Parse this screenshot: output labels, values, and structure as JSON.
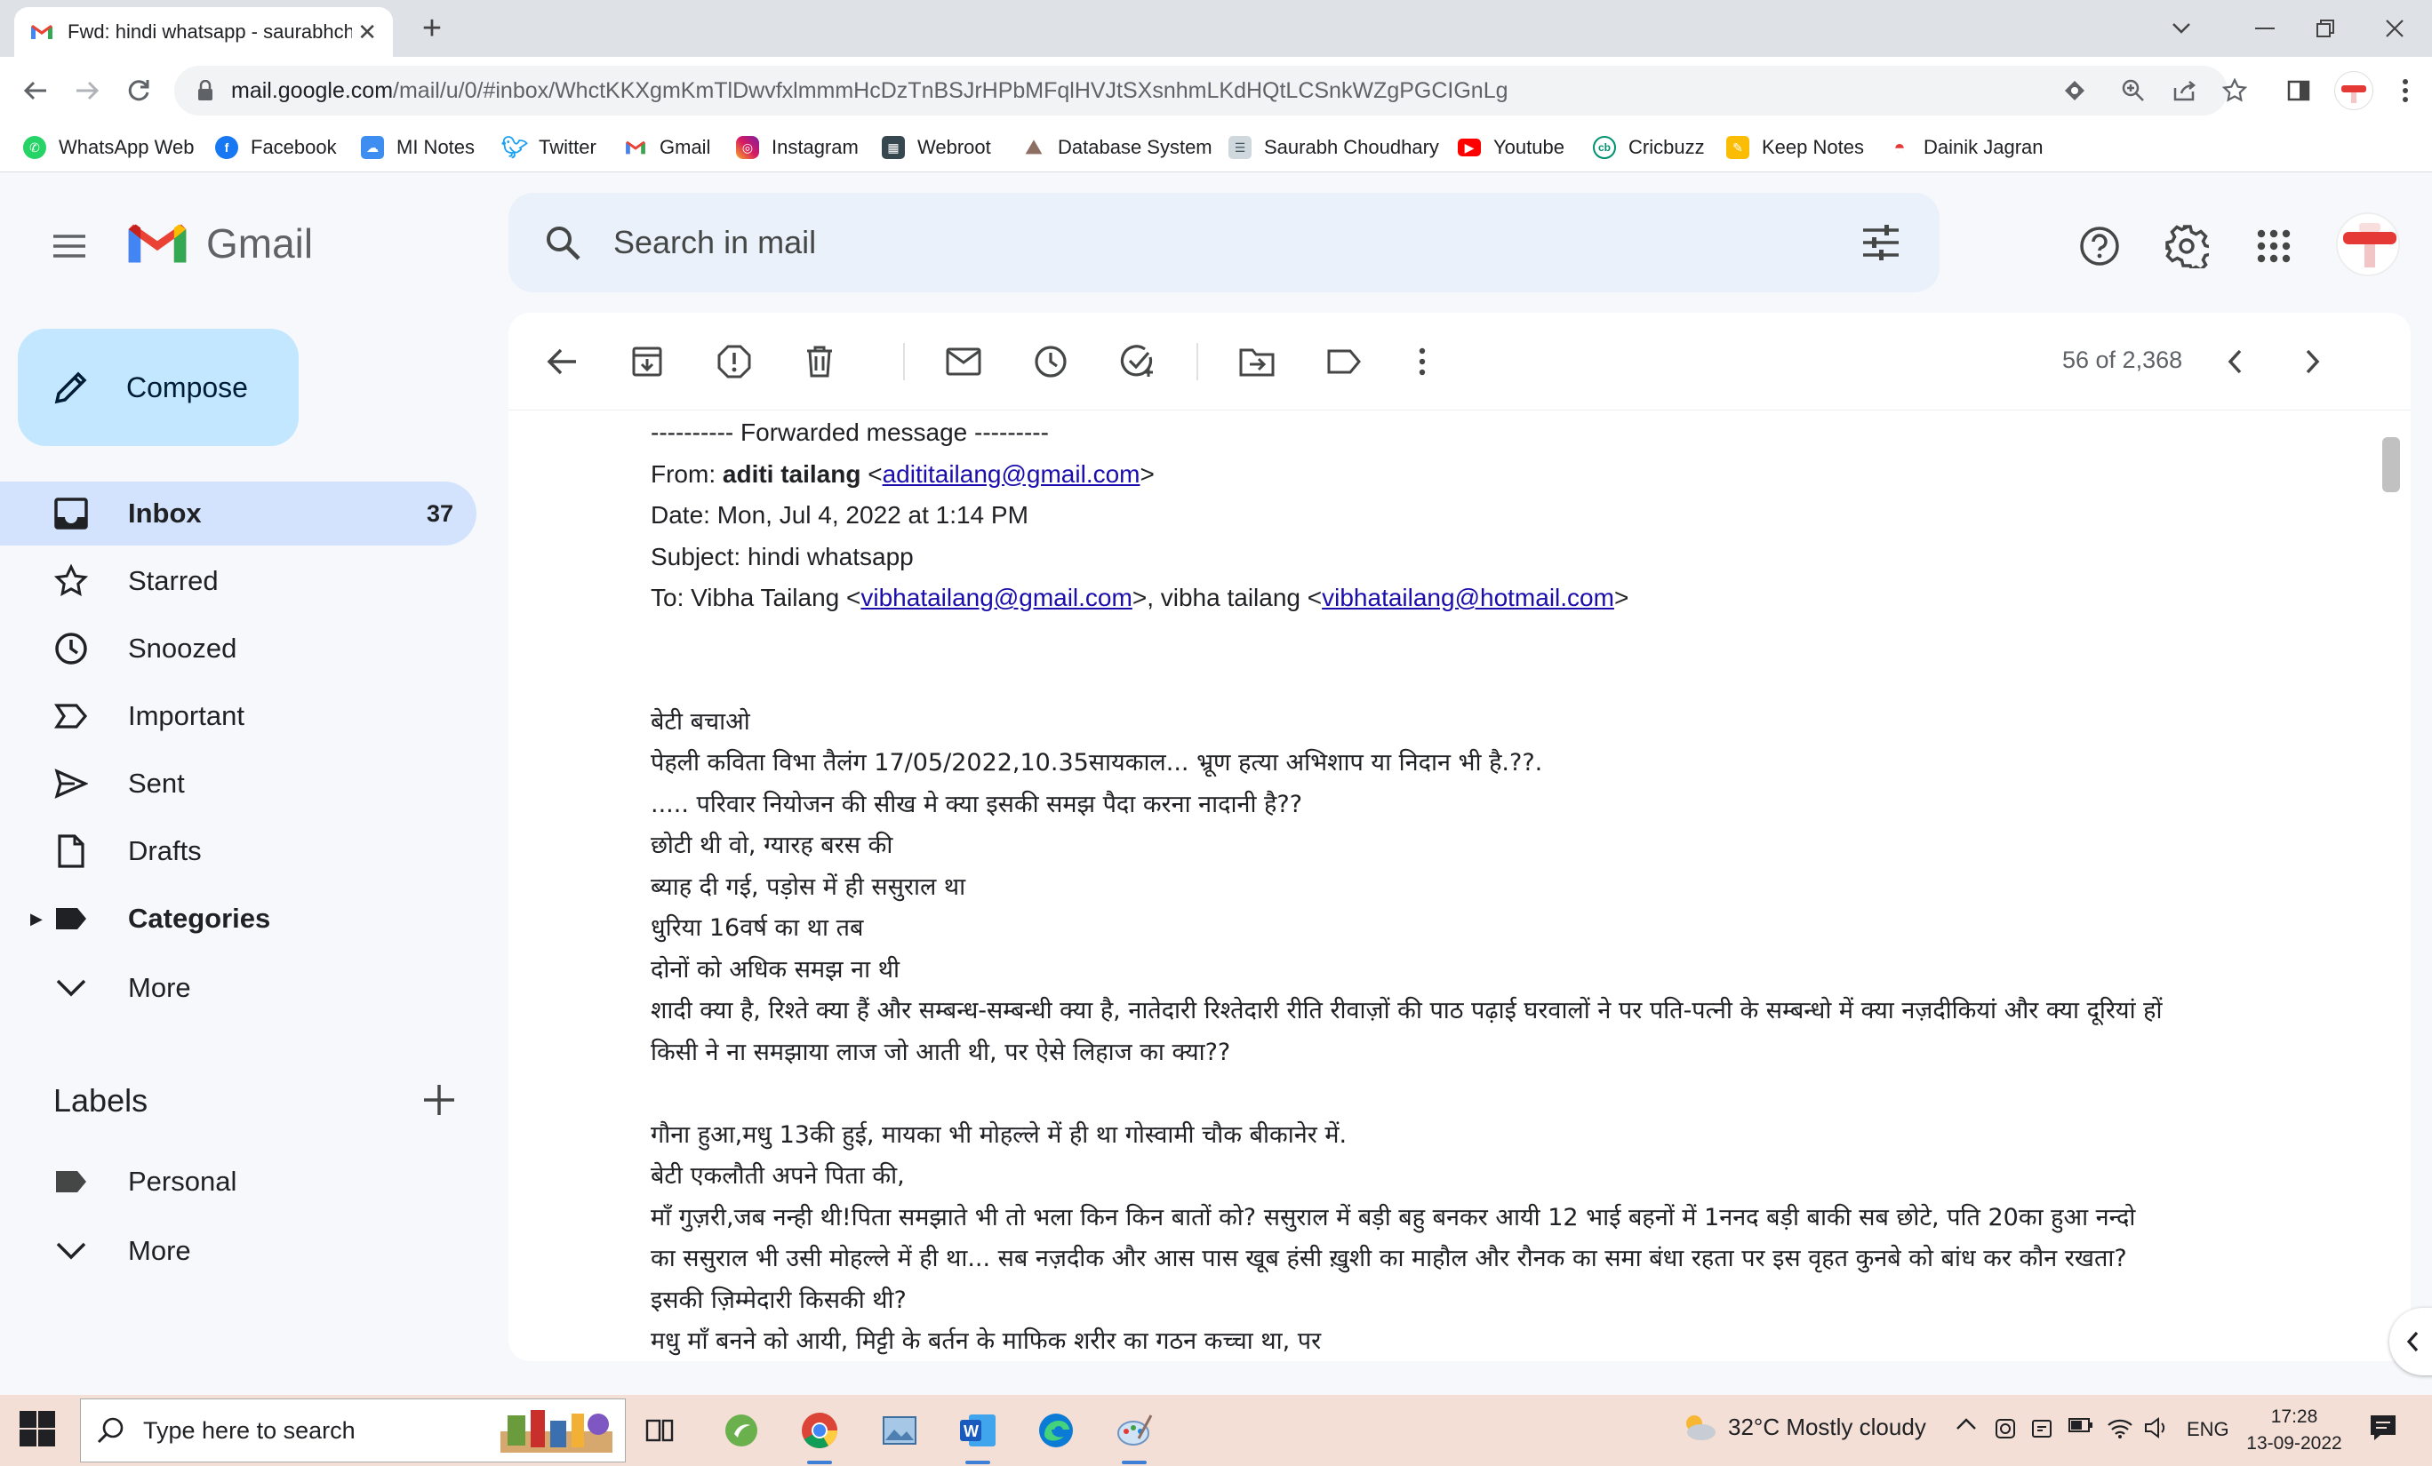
{
  "browser": {
    "tab_title": "Fwd: hindi whatsapp - saurabhch",
    "new_tab": "+",
    "url_host": "mail.google.com",
    "url_path": "/mail/u/0/#inbox/WhctKKXgmKmTlDwvfxlmmmHcDzTnBSJrHPbMFqlHVJtSXsnhmLKdHQtLCSnkWZgPGCIGnLg",
    "bookmarks": [
      "WhatsApp Web",
      "Facebook",
      "MI Notes",
      "Twitter",
      "Gmail",
      "Instagram",
      "Webroot",
      "Database System",
      "Saurabh Choudhary",
      "Youtube",
      "Cricbuzz",
      "Keep Notes",
      "Dainik Jagran"
    ]
  },
  "gmail": {
    "logo_text": "Gmail",
    "search_placeholder": "Search in mail",
    "compose_label": "Compose",
    "nav": [
      {
        "label": "Inbox",
        "count": "37"
      },
      {
        "label": "Starred"
      },
      {
        "label": "Snoozed"
      },
      {
        "label": "Important"
      },
      {
        "label": "Sent"
      },
      {
        "label": "Drafts"
      },
      {
        "label": "Categories"
      },
      {
        "label": "More"
      }
    ],
    "labels_heading": "Labels",
    "labels": [
      {
        "label": "Personal"
      },
      {
        "label": "More"
      }
    ],
    "pager": "56 of 2,368"
  },
  "email": {
    "fwd_header": "---------- Forwarded message ---------",
    "from_label": "From: ",
    "from_name": "aditi tailang",
    "from_email": "adititailang@gmail.com",
    "date": "Date: Mon, Jul 4, 2022 at 1:14 PM",
    "subject": "Subject: hindi whatsapp",
    "to_prefix": "To: Vibha Tailang <",
    "to_email1": "vibhatailang@gmail.com",
    "to_mid": ">, vibha tailang <",
    "to_email2": "vibhatailang@hotmail.com",
    "to_suffix": ">",
    "body_lines": [
      "बेटी बचाओ",
      "पेहली कविता विभा तैलंग 17/05/2022,10.35सायकाल... भ्रूण हत्या अभिशाप या निदान भी है.??.",
      "..... परिवार नियोजन की सीख मे क्या इसकी समझ पैदा करना नादानी है??",
      "छोटी थी वो, ग्यारह बरस की",
      "ब्याह दी गई, पड़ोस में ही ससुराल था",
      "धुरिया 16वर्ष का था तब",
      "दोनों को अधिक समझ ना थी",
      "शादी क्या है, रिश्ते क्या हैं और सम्बन्ध-सम्बन्धी क्या है, नातेदारी रिश्तेदारी रीति रीवाज़ों की पाठ पढ़ाई घरवालों ने पर पति-पत्नी के सम्बन्धो में क्या नज़दीकियां और क्या दूरियां हों",
      "किसी ने ना समझाया लाज जो आती थी, पर ऐसे लिहाज का क्या??",
      "",
      "गौना हुआ,मधु 13की हुई, मायका भी मोहल्ले में ही था गोस्वामी चौक बीकानेर में.",
      " बेटी एकलौती अपने पिता की,",
      " माँ गुज़री,जब नन्ही थी!पिता समझाते भी तो भला किन किन बातों को? ससुराल में बड़ी बहु बनकर आयी 12 भाई बहनों में 1ननद बड़ी बाकी सब छोटे, पति 20का हुआ नन्दो",
      "का ससुराल भी उसी मोहल्ले में ही था... सब नज़दीक और आस पास खूब हंसी ख़ुशी का माहौल और रौनक का समा बंधा रहता पर इस वृहत कुनबे को बांध कर कौन रखता?",
      "इसकी ज़िम्मेदारी किसकी थी?",
      "मधु माँ बनने को आयी, मिट्टी के बर्तन के माफिक शरीर का गठन कच्चा था, पर"
    ]
  },
  "taskbar": {
    "search_placeholder": "Type here to search",
    "weather": "32°C  Mostly cloudy",
    "lang": "ENG",
    "time": "17:28",
    "date": "13-09-2022"
  },
  "colors": {
    "gmail_bg": "#f6f8fc",
    "compose_bg": "#c2e7ff",
    "active_nav": "#d3e3fd",
    "search_bg": "#eaf1fb",
    "link": "#1a0dab",
    "taskbar_bg": "#f3dfd6"
  }
}
